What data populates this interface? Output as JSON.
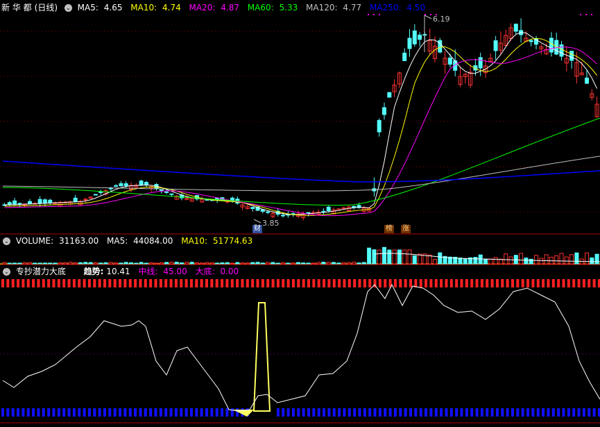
{
  "price_panel": {
    "stock_name": "新 华 都",
    "period": "(日线)",
    "ma_items": [
      {
        "label": "MA5:",
        "value": "4.65",
        "color": "#ffffff"
      },
      {
        "label": "MA10:",
        "value": "4.74",
        "color": "#ffff00"
      },
      {
        "label": "MA20:",
        "value": "4.87",
        "color": "#ff00ff"
      },
      {
        "label": "MA60:",
        "value": "5.33",
        "color": "#00ff00"
      },
      {
        "label": "MA120:",
        "value": "4.77",
        "color": "#c0c0c0"
      },
      {
        "label": "MA250:",
        "value": "4.50",
        "color": "#0000ff"
      }
    ],
    "high_label": "6.19",
    "low_label": "3.85",
    "markers": [
      {
        "text": "财"
      },
      {
        "text": "榜"
      },
      {
        "text": "涨"
      }
    ]
  },
  "volume_panel": {
    "name": "VOLUME:",
    "value": "31163.00",
    "ma5_label": "MA5:",
    "ma5_value": "44084.00",
    "ma10_label": "MA10:",
    "ma10_value": "51774.63"
  },
  "indicator_panel": {
    "name": "专抄潜力大底",
    "trend_label": "趋势:",
    "trend_value": "10.41",
    "mid_label": "中线:",
    "mid_value": "45.00",
    "bottom_label": "大底:",
    "bottom_value": "0.00"
  },
  "colors": {
    "up": "#ff3232",
    "down": "#54ffff",
    "separator": "#b00000",
    "grid": "#8b0000",
    "top_bar": "#ff2020",
    "bottom_bar": "#1010ff",
    "signal": "#ffff60"
  }
}
